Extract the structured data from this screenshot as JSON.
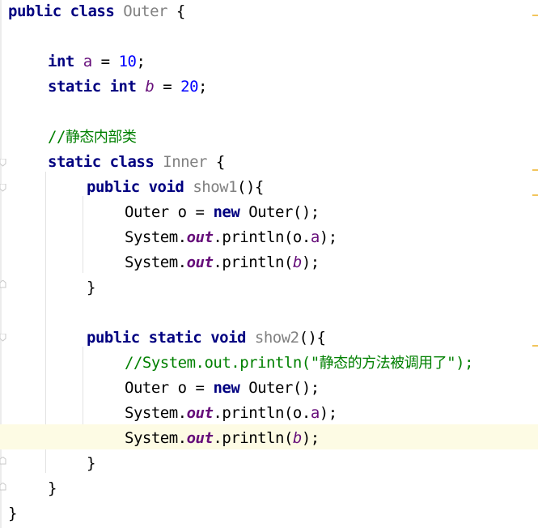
{
  "editor": {
    "language": "java",
    "colors": {
      "keyword": "#000080",
      "number": "#0000ff",
      "field": "#660e7a",
      "comment": "#008000",
      "unused_declaration": "#808080",
      "current_line": "#fdfbe4",
      "scroll_marker": "#f2c55c"
    },
    "tokens": {
      "public": "public",
      "class": "class",
      "static": "static",
      "int": "int",
      "void": "void",
      "new": "new",
      "outer": "Outer",
      "inner": "Inner",
      "a": "a",
      "b": "b",
      "o": "o",
      "ten": "10",
      "twenty": "20",
      "show1": "show1",
      "show2": "show2",
      "system": "System",
      "out": "out",
      "println": "println"
    },
    "comments": {
      "static_inner_class": "//静态内部类",
      "commented_println": "//System.out.println(\"静态的方法被调用了\");"
    },
    "current_line": 18
  }
}
